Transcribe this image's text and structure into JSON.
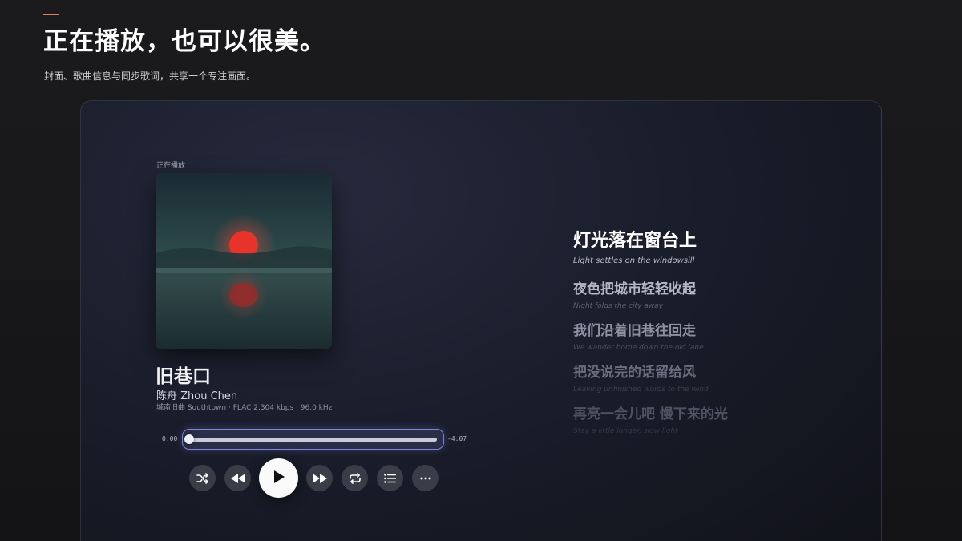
{
  "page": {
    "headline": "正在播放，也可以很美。",
    "subheadline": "封面、歌曲信息与同步歌词，共享一个专注画面。"
  },
  "player": {
    "now_playing_label": "正在播放",
    "track": {
      "title": "旧巷口",
      "artist": "陈舟 Zhou Chen",
      "meta": "城南旧曲 Southtown · FLAC 2,304 kbps · 96.0 kHz"
    },
    "progress": {
      "elapsed": "0:00",
      "remaining": "-4:07",
      "fraction": 0.0
    },
    "controls": {
      "shuffle_icon": "shuffle-icon",
      "previous_icon": "rewind-icon",
      "play_icon": "play-icon",
      "next_icon": "fast-forward-icon",
      "repeat_icon": "repeat-icon",
      "queue_icon": "list-icon",
      "more_icon": "more-horizontal-icon"
    }
  },
  "lyrics": [
    {
      "zh": "灯光落在窗台上",
      "en": "Light settles on the windowsill",
      "active": true
    },
    {
      "zh": "夜色把城市轻轻收起",
      "en": "Night folds the city away",
      "active": false
    },
    {
      "zh": "我们沿着旧巷往回走",
      "en": "We wander home down the old lane",
      "active": false
    },
    {
      "zh": "把没说完的话留给风",
      "en": "Leaving unfinished words to the wind",
      "active": false
    },
    {
      "zh": "再亮一会儿吧 慢下来的光",
      "en": "Stay a little longer, slow light",
      "active": false
    }
  ],
  "colors": {
    "accent": "#e0805a",
    "seek_highlight": "#7d86d6",
    "background": "#161618",
    "panel": "#1a1d2b"
  }
}
